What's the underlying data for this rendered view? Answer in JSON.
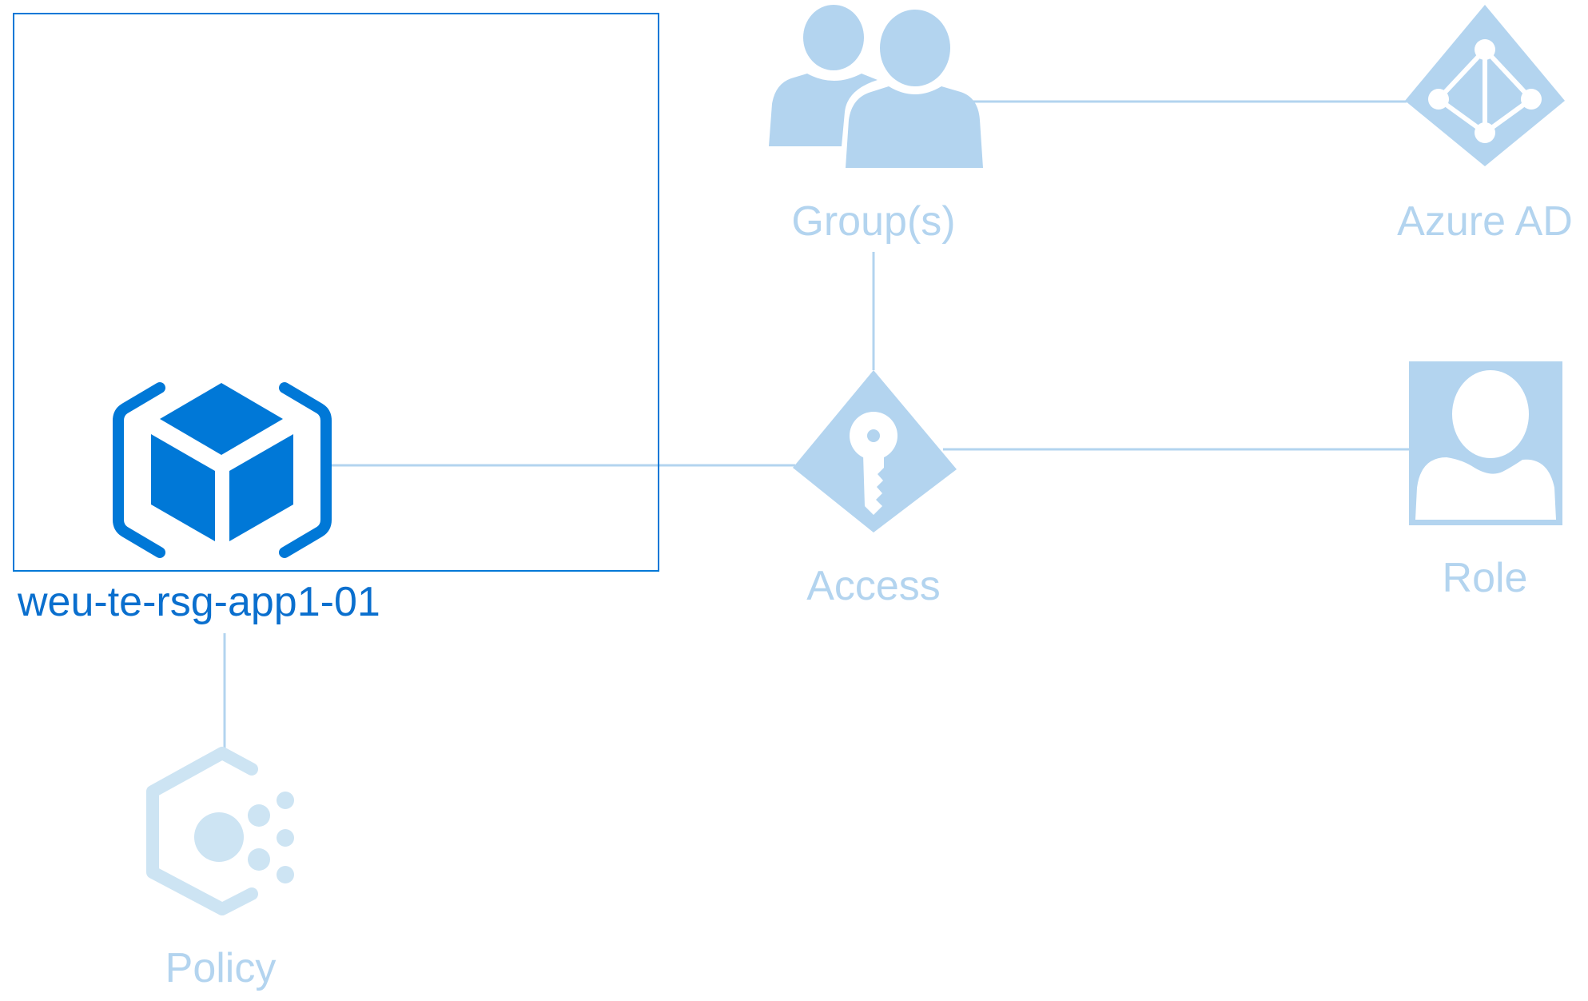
{
  "resource_group": {
    "label": "weu-te-rsg-app1-01",
    "icon": "resource-group-cube-icon"
  },
  "nodes": {
    "groups": {
      "label": "Group(s)",
      "icon": "users-icon"
    },
    "azure_ad": {
      "label": "Azure AD",
      "icon": "azure-ad-diamond-icon"
    },
    "access": {
      "label": "Access",
      "icon": "key-diamond-icon"
    },
    "role": {
      "label": "Role",
      "icon": "user-role-icon"
    },
    "policy": {
      "label": "Policy",
      "icon": "policy-hexagon-icon"
    }
  },
  "colors": {
    "primary": "#0078d7",
    "label_primary": "#0a6fce",
    "light": "#b3d4ef",
    "line": "#b3d4ef",
    "policy": "#cde4f3"
  }
}
